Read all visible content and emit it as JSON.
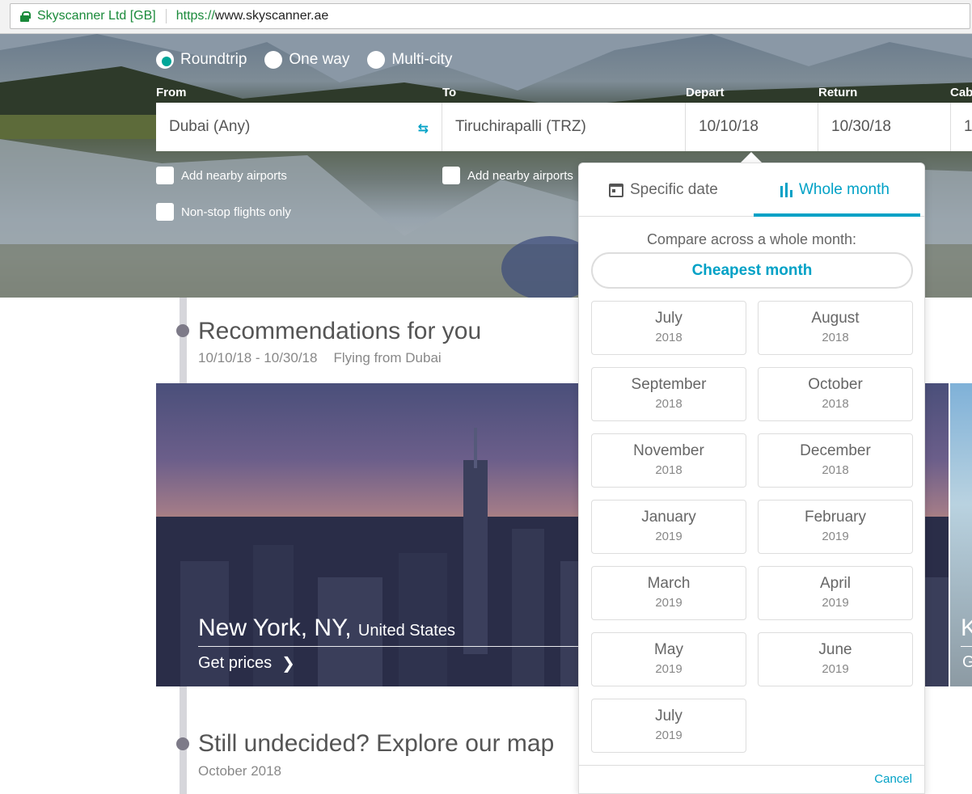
{
  "browser": {
    "site_identity": "Skyscanner Ltd [GB]",
    "url_scheme": "https://",
    "url_host": "www.skyscanner.ae"
  },
  "search": {
    "trip_types": [
      "Roundtrip",
      "One way",
      "Multi-city"
    ],
    "selected_trip_type": "Roundtrip",
    "labels": {
      "from": "From",
      "to": "To",
      "depart": "Depart",
      "return": "Return",
      "cabin": "Cab"
    },
    "from_value": "Dubai (Any)",
    "to_value": "Tiruchirapalli (TRZ)",
    "depart_value": "10/10/18",
    "return_value": "10/30/18",
    "cabin_value": "1",
    "nearby_from": "Add nearby airports",
    "nearby_to": "Add nearby airports",
    "nonstop": "Non-stop flights only"
  },
  "recommendations": {
    "title": "Recommendations for you",
    "dates": "10/10/18 - 10/30/18",
    "origin": "Flying from Dubai",
    "card": {
      "city": "New York, NY,",
      "country": "United States",
      "cta": "Get prices"
    },
    "next_card_initial": "K",
    "next_card_cta_initial": "G"
  },
  "map_section": {
    "title": "Still undecided? Explore our map",
    "subtitle": "October 2018"
  },
  "date_popup": {
    "tab_specific": "Specific date",
    "tab_whole": "Whole month",
    "compare_text": "Compare across a whole month:",
    "cheapest": "Cheapest month",
    "months": [
      {
        "month": "July",
        "year": "2018"
      },
      {
        "month": "August",
        "year": "2018"
      },
      {
        "month": "September",
        "year": "2018"
      },
      {
        "month": "October",
        "year": "2018"
      },
      {
        "month": "November",
        "year": "2018"
      },
      {
        "month": "December",
        "year": "2018"
      },
      {
        "month": "January",
        "year": "2019"
      },
      {
        "month": "February",
        "year": "2019"
      },
      {
        "month": "March",
        "year": "2019"
      },
      {
        "month": "April",
        "year": "2019"
      },
      {
        "month": "May",
        "year": "2019"
      },
      {
        "month": "June",
        "year": "2019"
      },
      {
        "month": "July",
        "year": "2019"
      }
    ],
    "cancel": "Cancel"
  },
  "colors": {
    "accent": "#00a1c6",
    "secure_green": "#1a8a3a",
    "radio_selected": "#00a698"
  }
}
